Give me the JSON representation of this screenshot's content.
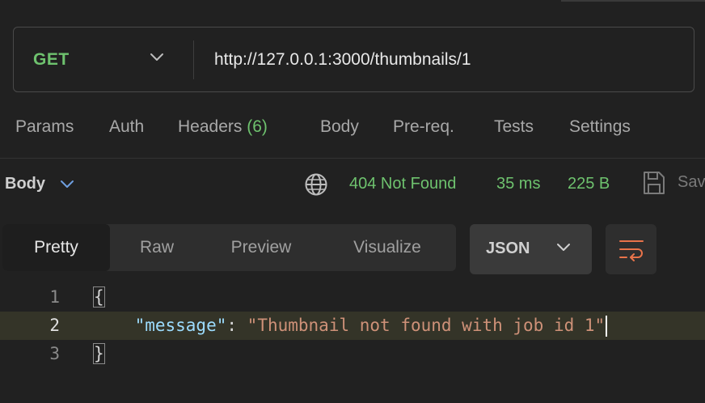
{
  "request": {
    "method": "GET",
    "url": "http://127.0.0.1:3000/thumbnails/1"
  },
  "tabs": {
    "params": "Params",
    "auth": "Auth",
    "headers": "Headers",
    "headers_count": "(6)",
    "body": "Body",
    "prereq": "Pre-req.",
    "tests": "Tests",
    "settings": "Settings"
  },
  "response": {
    "section_label": "Body",
    "status": "404 Not Found",
    "time": "35 ms",
    "size": "225 B",
    "save_label": "Sav"
  },
  "view": {
    "pretty": "Pretty",
    "raw": "Raw",
    "preview": "Preview",
    "visualize": "Visualize",
    "format": "JSON"
  },
  "code": {
    "line_numbers": [
      "1",
      "2",
      "3"
    ],
    "open_brace": "{",
    "indent": "    ",
    "key": "\"message\"",
    "colon": ": ",
    "value": "\"Thumbnail not found with job id 1\"",
    "close_brace": "}"
  },
  "colors": {
    "background": "#212121",
    "success_green": "#6ec26e",
    "json_key": "#9cdcfe",
    "json_string": "#ce9178",
    "wrap_accent": "#e8734a"
  },
  "icons": [
    "chevron-down-icon",
    "globe-icon",
    "save-icon",
    "wrap-lines-icon"
  ]
}
